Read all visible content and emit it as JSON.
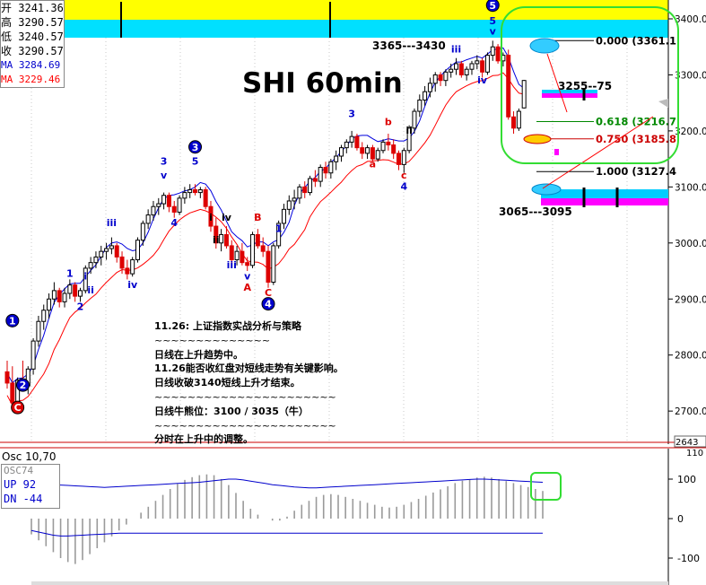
{
  "chart_data": {
    "type": "candlestick",
    "title": "SHI 60min",
    "price_axis": {
      "ticks": [
        "3400.0",
        "3300.0",
        "3200.0",
        "3100.0",
        "3000.0",
        "2900.0",
        "2800.0",
        "2700.0"
      ],
      "values": [
        3400,
        3300,
        3200,
        3100,
        3000,
        2900,
        2800,
        2700
      ],
      "last_price_tag": "2643"
    },
    "osc_axis": {
      "ticks": [
        "100",
        "0",
        "-100"
      ],
      "values": [
        100,
        0,
        -100
      ],
      "partial_tick": "110"
    },
    "ohlc_box": [
      {
        "label": "开",
        "value": "3241.36",
        "color": "#000000"
      },
      {
        "label": "高",
        "value": "3290.57",
        "color": "#000000"
      },
      {
        "label": "低",
        "value": "3240.57",
        "color": "#000000"
      },
      {
        "label": "收",
        "value": "3290.57",
        "color": "#000000"
      },
      {
        "label": "MA",
        "value": "3284.69",
        "color": "#0000cc"
      },
      {
        "label": "MA",
        "value": "3229.46",
        "color": "#ff0000"
      }
    ],
    "fib_levels": [
      {
        "text": "0.000 (3361.1",
        "price": 3361.1,
        "color": "#000000"
      },
      {
        "text": "0.618 (3216.7",
        "price": 3216.7,
        "color": "#008800"
      },
      {
        "text": "0.750 (3185.8",
        "price": 3185.8,
        "color": "#cc0000"
      },
      {
        "text": "1.000 (3127.4",
        "price": 3127.4,
        "color": "#000000"
      }
    ],
    "targets": [
      {
        "text": "3365---3430"
      },
      {
        "text": "3255--75"
      },
      {
        "text": "3065---3095"
      }
    ],
    "wave_labels": [
      {
        "text": "1",
        "price": 2855,
        "idx": 1,
        "color": "#ffffff",
        "circle": "#0000cc"
      },
      {
        "text": "2",
        "price": 2740,
        "idx": 3,
        "color": "#ffffff",
        "circle": "#0000cc"
      },
      {
        "text": "C",
        "price": 2700,
        "idx": 2,
        "color": "#ffffff",
        "circle": "#dd0000"
      },
      {
        "text": "1",
        "price": 2940,
        "idx": 12,
        "color": "#0000cc"
      },
      {
        "text": "2",
        "price": 2880,
        "idx": 14,
        "color": "#0000cc"
      },
      {
        "text": "i",
        "price": 2935,
        "idx": 15,
        "color": "#0000cc"
      },
      {
        "text": "ii",
        "price": 2910,
        "idx": 16,
        "color": "#0000cc"
      },
      {
        "text": "iii",
        "price": 3030,
        "idx": 20,
        "color": "#0000cc"
      },
      {
        "text": "iv",
        "price": 2920,
        "idx": 24,
        "color": "#0000cc"
      },
      {
        "text": "3",
        "price": 3140,
        "idx": 30,
        "color": "#0000cc"
      },
      {
        "text": "v",
        "price": 3115,
        "idx": 30,
        "color": "#0000cc"
      },
      {
        "text": "4",
        "price": 3030,
        "idx": 32,
        "color": "#0000cc"
      },
      {
        "text": "3",
        "price": 3165,
        "idx": 36,
        "color": "#ffffff",
        "circle": "#0000cc"
      },
      {
        "text": "5",
        "price": 3140,
        "idx": 36,
        "color": "#0000cc"
      },
      {
        "text": "i",
        "price": 3040,
        "idx": 39,
        "color": "#000000"
      },
      {
        "text": "ii",
        "price": 3000,
        "idx": 40,
        "color": "#000000"
      },
      {
        "text": "iv",
        "price": 3040,
        "idx": 42,
        "color": "#000000"
      },
      {
        "text": "iii",
        "price": 2955,
        "idx": 43,
        "color": "#0000cc"
      },
      {
        "text": "v",
        "price": 2935,
        "idx": 46,
        "color": "#0000cc"
      },
      {
        "text": "A",
        "price": 2915,
        "idx": 46,
        "color": "#dd0000"
      },
      {
        "text": "B",
        "price": 3040,
        "idx": 48,
        "color": "#dd0000"
      },
      {
        "text": "C",
        "price": 2905,
        "idx": 50,
        "color": "#dd0000"
      },
      {
        "text": "4",
        "price": 2885,
        "idx": 50,
        "color": "#ffffff",
        "circle": "#0000cc"
      },
      {
        "text": "1",
        "price": 3020,
        "idx": 52,
        "color": "#0000cc"
      },
      {
        "text": "3",
        "price": 3225,
        "idx": 66,
        "color": "#0000cc"
      },
      {
        "text": "a",
        "price": 3135,
        "idx": 70,
        "color": "#dd0000"
      },
      {
        "text": "b",
        "price": 3210,
        "idx": 73,
        "color": "#dd0000"
      },
      {
        "text": "ii",
        "price": 3195,
        "idx": 77,
        "color": "#000000"
      },
      {
        "text": "c",
        "price": 3115,
        "idx": 76,
        "color": "#dd0000"
      },
      {
        "text": "4",
        "price": 3095,
        "idx": 76,
        "color": "#0000cc"
      },
      {
        "text": "iii",
        "price": 3340,
        "idx": 86,
        "color": "#0000cc"
      },
      {
        "text": "iv",
        "price": 3285,
        "idx": 91,
        "color": "#0000cc"
      },
      {
        "text": "5",
        "price": 3390,
        "idx": 93,
        "color": "#0000cc"
      },
      {
        "text": "v",
        "price": 3372,
        "idx": 93,
        "color": "#0000cc"
      },
      {
        "text": "5",
        "price": 3418,
        "idx": 93,
        "color": "#ffffff",
        "circle": "#0000cc"
      }
    ],
    "candles": [
      {
        "o": 2770,
        "h": 2790,
        "l": 2740,
        "c": 2750
      },
      {
        "o": 2750,
        "h": 2780,
        "l": 2700,
        "c": 2715
      },
      {
        "o": 2715,
        "h": 2760,
        "l": 2705,
        "c": 2755
      },
      {
        "o": 2755,
        "h": 2790,
        "l": 2735,
        "c": 2745
      },
      {
        "o": 2745,
        "h": 2780,
        "l": 2730,
        "c": 2775
      },
      {
        "o": 2775,
        "h": 2830,
        "l": 2765,
        "c": 2825
      },
      {
        "o": 2825,
        "h": 2870,
        "l": 2815,
        "c": 2860
      },
      {
        "o": 2860,
        "h": 2890,
        "l": 2845,
        "c": 2880
      },
      {
        "o": 2880,
        "h": 2910,
        "l": 2865,
        "c": 2900
      },
      {
        "o": 2900,
        "h": 2930,
        "l": 2890,
        "c": 2915
      },
      {
        "o": 2915,
        "h": 2920,
        "l": 2885,
        "c": 2895
      },
      {
        "o": 2895,
        "h": 2920,
        "l": 2885,
        "c": 2910
      },
      {
        "o": 2910,
        "h": 2935,
        "l": 2900,
        "c": 2925
      },
      {
        "o": 2925,
        "h": 2930,
        "l": 2895,
        "c": 2905
      },
      {
        "o": 2905,
        "h": 2920,
        "l": 2895,
        "c": 2915
      },
      {
        "o": 2915,
        "h": 2960,
        "l": 2910,
        "c": 2955
      },
      {
        "o": 2955,
        "h": 2975,
        "l": 2945,
        "c": 2965
      },
      {
        "o": 2965,
        "h": 2985,
        "l": 2955,
        "c": 2975
      },
      {
        "o": 2975,
        "h": 2995,
        "l": 2960,
        "c": 2985
      },
      {
        "o": 2985,
        "h": 3000,
        "l": 2970,
        "c": 2990
      },
      {
        "o": 2990,
        "h": 3010,
        "l": 2980,
        "c": 2995
      },
      {
        "o": 2995,
        "h": 3000,
        "l": 2965,
        "c": 2975
      },
      {
        "o": 2975,
        "h": 2985,
        "l": 2945,
        "c": 2955
      },
      {
        "o": 2955,
        "h": 2970,
        "l": 2935,
        "c": 2945
      },
      {
        "o": 2945,
        "h": 2975,
        "l": 2940,
        "c": 2970
      },
      {
        "o": 2970,
        "h": 3010,
        "l": 2965,
        "c": 3005
      },
      {
        "o": 3005,
        "h": 3040,
        "l": 2995,
        "c": 3035
      },
      {
        "o": 3035,
        "h": 3060,
        "l": 3025,
        "c": 3050
      },
      {
        "o": 3050,
        "h": 3075,
        "l": 3040,
        "c": 3065
      },
      {
        "o": 3065,
        "h": 3080,
        "l": 3050,
        "c": 3070
      },
      {
        "o": 3070,
        "h": 3090,
        "l": 3060,
        "c": 3085
      },
      {
        "o": 3085,
        "h": 3090,
        "l": 3055,
        "c": 3065
      },
      {
        "o": 3065,
        "h": 3075,
        "l": 3045,
        "c": 3055
      },
      {
        "o": 3055,
        "h": 3085,
        "l": 3050,
        "c": 3080
      },
      {
        "o": 3080,
        "h": 3100,
        "l": 3070,
        "c": 3090
      },
      {
        "o": 3090,
        "h": 3105,
        "l": 3080,
        "c": 3095
      },
      {
        "o": 3095,
        "h": 3105,
        "l": 3085,
        "c": 3090
      },
      {
        "o": 3090,
        "h": 3100,
        "l": 3080,
        "c": 3095
      },
      {
        "o": 3095,
        "h": 3100,
        "l": 3060,
        "c": 3065
      },
      {
        "o": 3065,
        "h": 3075,
        "l": 3020,
        "c": 3030
      },
      {
        "o": 3030,
        "h": 3045,
        "l": 2990,
        "c": 3000
      },
      {
        "o": 3000,
        "h": 3025,
        "l": 2985,
        "c": 3015
      },
      {
        "o": 3015,
        "h": 3030,
        "l": 2990,
        "c": 2995
      },
      {
        "o": 2995,
        "h": 3005,
        "l": 2960,
        "c": 2970
      },
      {
        "o": 2970,
        "h": 2995,
        "l": 2960,
        "c": 2985
      },
      {
        "o": 2985,
        "h": 3000,
        "l": 2960,
        "c": 2965
      },
      {
        "o": 2965,
        "h": 2975,
        "l": 2950,
        "c": 2960
      },
      {
        "o": 2960,
        "h": 3020,
        "l": 2955,
        "c": 3015
      },
      {
        "o": 3015,
        "h": 3025,
        "l": 2990,
        "c": 2995
      },
      {
        "o": 2995,
        "h": 3010,
        "l": 2975,
        "c": 2985
      },
      {
        "o": 2985,
        "h": 2995,
        "l": 2920,
        "c": 2930
      },
      {
        "o": 2930,
        "h": 3000,
        "l": 2925,
        "c": 2995
      },
      {
        "o": 2995,
        "h": 3040,
        "l": 2990,
        "c": 3035
      },
      {
        "o": 3035,
        "h": 3070,
        "l": 3025,
        "c": 3060
      },
      {
        "o": 3060,
        "h": 3085,
        "l": 3050,
        "c": 3075
      },
      {
        "o": 3075,
        "h": 3095,
        "l": 3060,
        "c": 3080
      },
      {
        "o": 3080,
        "h": 3105,
        "l": 3070,
        "c": 3100
      },
      {
        "o": 3100,
        "h": 3110,
        "l": 3080,
        "c": 3090
      },
      {
        "o": 3090,
        "h": 3120,
        "l": 3085,
        "c": 3115
      },
      {
        "o": 3115,
        "h": 3130,
        "l": 3100,
        "c": 3110
      },
      {
        "o": 3110,
        "h": 3140,
        "l": 3100,
        "c": 3135
      },
      {
        "o": 3135,
        "h": 3145,
        "l": 3115,
        "c": 3125
      },
      {
        "o": 3125,
        "h": 3150,
        "l": 3115,
        "c": 3145
      },
      {
        "o": 3145,
        "h": 3165,
        "l": 3130,
        "c": 3155
      },
      {
        "o": 3155,
        "h": 3175,
        "l": 3145,
        "c": 3170
      },
      {
        "o": 3170,
        "h": 3185,
        "l": 3160,
        "c": 3180
      },
      {
        "o": 3180,
        "h": 3200,
        "l": 3170,
        "c": 3190
      },
      {
        "o": 3190,
        "h": 3195,
        "l": 3165,
        "c": 3170
      },
      {
        "o": 3170,
        "h": 3180,
        "l": 3150,
        "c": 3160
      },
      {
        "o": 3160,
        "h": 3175,
        "l": 3150,
        "c": 3170
      },
      {
        "o": 3170,
        "h": 3175,
        "l": 3145,
        "c": 3150
      },
      {
        "o": 3150,
        "h": 3170,
        "l": 3145,
        "c": 3165
      },
      {
        "o": 3165,
        "h": 3185,
        "l": 3160,
        "c": 3180
      },
      {
        "o": 3180,
        "h": 3195,
        "l": 3165,
        "c": 3175
      },
      {
        "o": 3175,
        "h": 3185,
        "l": 3150,
        "c": 3160
      },
      {
        "o": 3160,
        "h": 3165,
        "l": 3130,
        "c": 3140
      },
      {
        "o": 3140,
        "h": 3170,
        "l": 3125,
        "c": 3165
      },
      {
        "o": 3165,
        "h": 3210,
        "l": 3160,
        "c": 3205
      },
      {
        "o": 3205,
        "h": 3240,
        "l": 3195,
        "c": 3235
      },
      {
        "o": 3235,
        "h": 3265,
        "l": 3225,
        "c": 3255
      },
      {
        "o": 3255,
        "h": 3280,
        "l": 3245,
        "c": 3270
      },
      {
        "o": 3270,
        "h": 3295,
        "l": 3260,
        "c": 3285
      },
      {
        "o": 3285,
        "h": 3305,
        "l": 3270,
        "c": 3300
      },
      {
        "o": 3300,
        "h": 3305,
        "l": 3280,
        "c": 3290
      },
      {
        "o": 3290,
        "h": 3310,
        "l": 3280,
        "c": 3305
      },
      {
        "o": 3305,
        "h": 3320,
        "l": 3295,
        "c": 3310
      },
      {
        "o": 3310,
        "h": 3330,
        "l": 3300,
        "c": 3320
      },
      {
        "o": 3320,
        "h": 3325,
        "l": 3295,
        "c": 3300
      },
      {
        "o": 3300,
        "h": 3315,
        "l": 3290,
        "c": 3310
      },
      {
        "o": 3310,
        "h": 3325,
        "l": 3300,
        "c": 3320
      },
      {
        "o": 3320,
        "h": 3335,
        "l": 3310,
        "c": 3325
      },
      {
        "o": 3325,
        "h": 3330,
        "l": 3295,
        "c": 3305
      },
      {
        "o": 3305,
        "h": 3340,
        "l": 3300,
        "c": 3335
      },
      {
        "o": 3335,
        "h": 3361,
        "l": 3325,
        "c": 3350
      },
      {
        "o": 3350,
        "h": 3355,
        "l": 3320,
        "c": 3325
      },
      {
        "o": 3325,
        "h": 3340,
        "l": 3315,
        "c": 3335
      },
      {
        "o": 3335,
        "h": 3345,
        "l": 3220,
        "c": 3225
      },
      {
        "o": 3225,
        "h": 3235,
        "l": 3195,
        "c": 3205
      },
      {
        "o": 3205,
        "h": 3240,
        "l": 3200,
        "c": 3235
      },
      {
        "o": 3241,
        "h": 3291,
        "l": 3240,
        "c": 3290
      }
    ],
    "osc_header": [
      {
        "label": "Osc 10,70",
        "color": "#000000"
      },
      {
        "label": "OSC74",
        "color": "#888888"
      },
      {
        "label": "UP  92",
        "color": "#0000cc"
      },
      {
        "label": "DN  -44",
        "color": "#0000cc"
      }
    ],
    "osc_up_line": [
      92,
      90,
      88,
      86,
      85,
      84,
      83,
      82,
      81,
      80,
      79,
      80,
      81,
      82,
      83,
      84,
      85,
      86,
      87,
      88,
      89,
      90,
      91,
      92,
      94,
      96,
      98,
      100,
      100,
      98,
      95,
      92,
      89,
      86,
      84,
      82,
      80,
      79,
      78,
      78,
      79,
      80,
      81,
      82,
      83,
      84,
      85,
      86,
      87,
      88,
      89,
      90,
      91,
      92,
      93,
      94,
      95,
      96,
      97,
      98,
      99,
      100,
      100,
      99,
      98,
      97,
      96,
      95,
      94,
      93,
      92
    ],
    "osc_dn_line": [
      -30,
      -34,
      -38,
      -42,
      -44,
      -44,
      -43,
      -42,
      -41,
      -40,
      -39,
      -38,
      -37,
      -37,
      -37,
      -37,
      -37,
      -37,
      -37,
      -37,
      -37,
      -37,
      -37,
      -37,
      -37,
      -37,
      -37,
      -37,
      -37,
      -37,
      -37,
      -37,
      -37,
      -37,
      -37,
      -37,
      -37,
      -37,
      -37,
      -37,
      -37,
      -37,
      -37,
      -37,
      -37,
      -37,
      -37,
      -37,
      -37,
      -37,
      -37,
      -37,
      -37,
      -37,
      -37,
      -37,
      -37,
      -37,
      -37,
      -37,
      -37,
      -37,
      -37,
      -37,
      -37,
      -37,
      -37,
      -37,
      -37,
      -37,
      -37
    ],
    "osc_hist": [
      -40,
      -55,
      -70,
      -85,
      -100,
      -110,
      -115,
      -105,
      -90,
      -75,
      -60,
      -45,
      -30,
      -15,
      0,
      15,
      30,
      45,
      60,
      75,
      88,
      98,
      105,
      110,
      112,
      110,
      100,
      85,
      65,
      45,
      25,
      10,
      0,
      -5,
      -5,
      5,
      20,
      35,
      45,
      55,
      60,
      62,
      60,
      55,
      50,
      45,
      40,
      35,
      30,
      28,
      30,
      35,
      42,
      50,
      58,
      66,
      74,
      82,
      90,
      96,
      100,
      104,
      106,
      104,
      100,
      95,
      90,
      85,
      80,
      75,
      70
    ]
  },
  "notes": {
    "heading": "11.26: 上证指数实战分析与策略",
    "sep1": "~~~~~~~~~~~~~~",
    "line1": "日线在上升趋势中。",
    "line2": "11.26能否收红盘对短线走势有关键影响。",
    "line3": "日线收破3140短线上升才结束。",
    "sep2": "~~~~~~~~~~~~~~~~~~~~~~",
    "line4": "日线牛熊位：3100 / 3035（牛）",
    "sep3": "~~~~~~~~~~~~~~~~~~~~~~",
    "line5": "分时在上升中的调整。"
  },
  "colors": {
    "band_yellow": "#ffff00",
    "band_cyan": "#00e0ff",
    "ma_fast": "#0000dd",
    "ma_slow": "#ff0000",
    "highlight_green": "#33dd33",
    "magenta": "#ff00ff"
  }
}
